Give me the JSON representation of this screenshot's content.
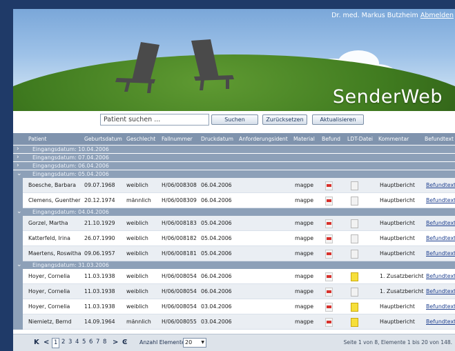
{
  "header": {
    "user_name": "Dr. med. Markus Butzheim",
    "logout_label": "Abmelden",
    "brand": "SenderWeb"
  },
  "search": {
    "placeholder": "Patient suchen ...",
    "search_label": "Suchen",
    "reset_label": "Zurücksetzen",
    "refresh_label": "Aktualisieren"
  },
  "columns": [
    "Patient",
    "Geburtsdatum",
    "Geschlecht",
    "Fallnummer",
    "Druckdatum",
    "Anforderungsident",
    "Material",
    "Befund",
    "LDT-Datei",
    "Kommentar",
    "Befundtext"
  ],
  "groups": [
    {
      "label": "Eingangsdatum: 10.04.2006",
      "expanded": false
    },
    {
      "label": "Eingangsdatum: 07.04.2006",
      "expanded": false
    },
    {
      "label": "Eingangsdatum: 06.04.2006",
      "expanded": false
    },
    {
      "label": "Eingangsdatum: 05.04.2006",
      "expanded": true
    },
    {
      "label": "Eingangsdatum: 04.04.2006",
      "expanded": true
    },
    {
      "label": "Eingangsdatum: 31.03.2006",
      "expanded": true
    }
  ],
  "rows": [
    {
      "patient": "Boesche, Barbara",
      "birth": "09.07.1968",
      "sex": "weiblich",
      "case": "H/06/008308",
      "printed": "06.04.2006",
      "material": "magpe",
      "comment": "Hauptbericht",
      "text": "Befundtext",
      "ldt": "gray"
    },
    {
      "patient": "Clemens, Guenther",
      "birth": "20.12.1974",
      "sex": "männlich",
      "case": "H/06/008309",
      "printed": "06.04.2006",
      "material": "magpe",
      "comment": "Hauptbericht",
      "text": "Befundtext",
      "ldt": "gray"
    },
    {
      "patient": "Gorzel, Martha",
      "birth": "21.10.1929",
      "sex": "weiblich",
      "case": "H/06/008183",
      "printed": "05.04.2006",
      "material": "magpe",
      "comment": "Hauptbericht",
      "text": "Befundtext",
      "ldt": "gray"
    },
    {
      "patient": "Katterfeld, Irina",
      "birth": "26.07.1990",
      "sex": "weiblich",
      "case": "H/06/008182",
      "printed": "05.04.2006",
      "material": "magpe",
      "comment": "Hauptbericht",
      "text": "Befundtext",
      "ldt": "gray"
    },
    {
      "patient": "Maertens, Roswitha",
      "birth": "09.06.1957",
      "sex": "weiblich",
      "case": "H/06/008181",
      "printed": "05.04.2006",
      "material": "magpe",
      "comment": "Hauptbericht",
      "text": "Befundtext",
      "ldt": "gray"
    },
    {
      "patient": "Hoyer, Cornelia",
      "birth": "11.03.1938",
      "sex": "weiblich",
      "case": "H/06/008054",
      "printed": "06.04.2006",
      "material": "magpe",
      "comment": "1. Zusatzbericht",
      "text": "Befundtext",
      "ldt": "yellow"
    },
    {
      "patient": "Hoyer, Cornelia",
      "birth": "11.03.1938",
      "sex": "weiblich",
      "case": "H/06/008054",
      "printed": "06.04.2006",
      "material": "magpe",
      "comment": "1. Zusatzbericht",
      "text": "Befundtext",
      "ldt": "gray"
    },
    {
      "patient": "Hoyer, Cornelia",
      "birth": "11.03.1938",
      "sex": "weiblich",
      "case": "H/06/008054",
      "printed": "03.04.2006",
      "material": "magpe",
      "comment": "Hauptbericht",
      "text": "Befundtext",
      "ldt": "yellow"
    },
    {
      "patient": "Niemietz, Bernd",
      "birth": "14.09.1964",
      "sex": "männlich",
      "case": "H/06/008055",
      "printed": "03.04.2006",
      "material": "magpe",
      "comment": "Hauptbericht",
      "text": "Befundtext",
      "ldt": "yellow"
    }
  ],
  "pager": {
    "first": "K",
    "prev": "<",
    "pages": [
      "1",
      "2",
      "3",
      "4",
      "5",
      "6",
      "7",
      "8"
    ],
    "current_page": "1",
    "next": ">",
    "last": "Ͼ",
    "page_size_label": "Anzahl Elemente:",
    "page_size": "20",
    "info": "Seite 1 von 8, Elemente 1 bis 20 von 148."
  },
  "colors": {
    "frame": "#1f3a68",
    "header_row": "#7f93ad",
    "group_row": "#8da0b8",
    "alt_row": "#eaeef3",
    "link": "#1d3f8f",
    "ldt_yellow": "#f6df3a"
  },
  "icons": {
    "befund": "pdf-icon",
    "ldt": "document-icon",
    "group_collapsed": "chevron-right-icon",
    "group_expanded": "chevron-down-icon"
  }
}
